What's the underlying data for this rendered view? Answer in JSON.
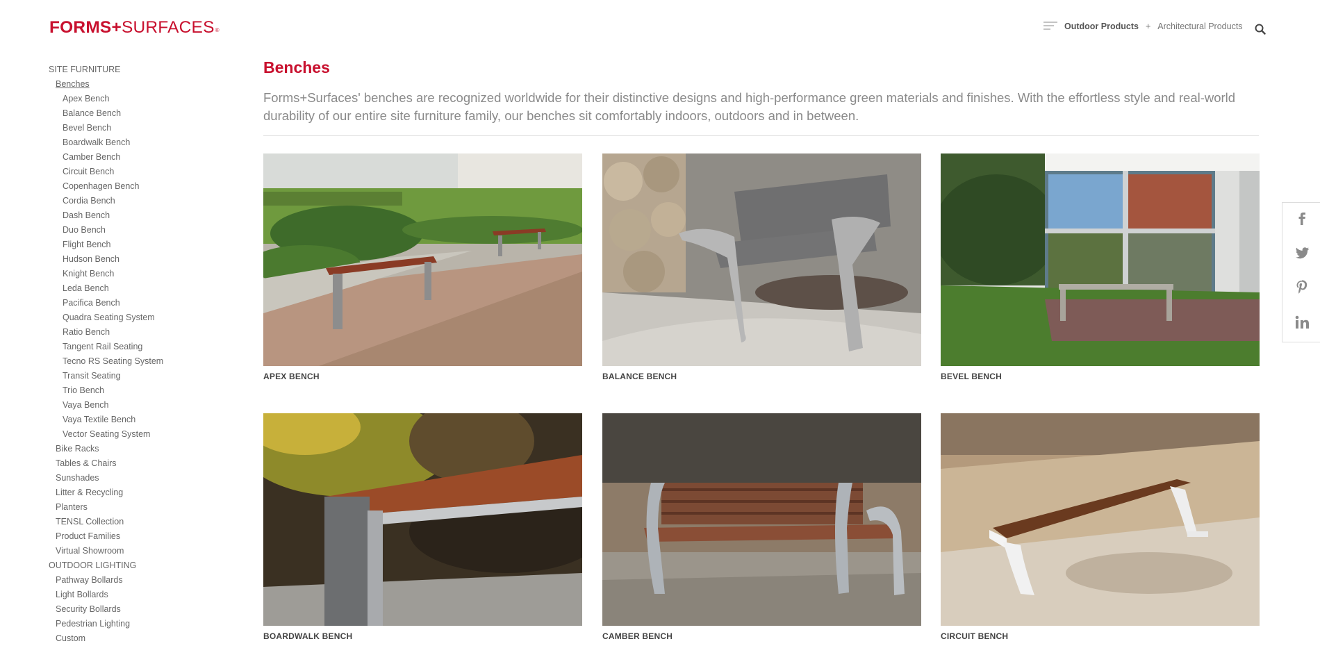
{
  "header": {
    "logo_forms": "FORMS+",
    "logo_surfaces": "SURFACES",
    "logo_reg": "®",
    "nav_outdoor": "Outdoor Products",
    "nav_plus": "+",
    "nav_architectural": "Architectural Products"
  },
  "sidebar": {
    "section1": "SITE FURNITURE",
    "active_category": "Benches",
    "bench_items": [
      "Apex Bench",
      "Balance Bench",
      "Bevel Bench",
      "Boardwalk Bench",
      "Camber Bench",
      "Circuit Bench",
      "Copenhagen Bench",
      "Cordia Bench",
      "Dash Bench",
      "Duo Bench",
      "Flight Bench",
      "Hudson Bench",
      "Knight Bench",
      "Leda Bench",
      "Pacifica Bench",
      "Quadra Seating System",
      "Ratio Bench",
      "Tangent Rail Seating",
      "Tecno RS Seating System",
      "Transit Seating",
      "Trio Bench",
      "Vaya Bench",
      "Vaya Textile Bench",
      "Vector Seating System"
    ],
    "categories": [
      "Bike Racks",
      "Tables & Chairs",
      "Sunshades",
      "Litter & Recycling",
      "Planters",
      "TENSL Collection",
      "Product Families",
      "Virtual Showroom"
    ],
    "section2": "OUTDOOR LIGHTING",
    "lighting_items": [
      "Pathway Bollards",
      "Light Bollards",
      "Security Bollards",
      "Pedestrian Lighting",
      "Custom"
    ]
  },
  "main": {
    "title": "Benches",
    "intro": "Forms+Surfaces' benches are recognized worldwide for their distinctive designs and high-performance green materials and finishes. With the effortless style and real-world durability of our entire site furniture family, our benches sit comfortably indoors, outdoors and in between.",
    "products": [
      {
        "caption": "APEX BENCH"
      },
      {
        "caption": "BALANCE BENCH"
      },
      {
        "caption": "BEVEL BENCH"
      },
      {
        "caption": "BOARDWALK BENCH"
      },
      {
        "caption": "CAMBER BENCH"
      },
      {
        "caption": "CIRCUIT BENCH"
      }
    ]
  },
  "social": [
    "facebook-icon",
    "twitter-icon",
    "pinterest-icon",
    "linkedin-icon"
  ],
  "colors": {
    "brand": "#c8102e",
    "text": "#555555",
    "muted": "#8a8a8a"
  }
}
